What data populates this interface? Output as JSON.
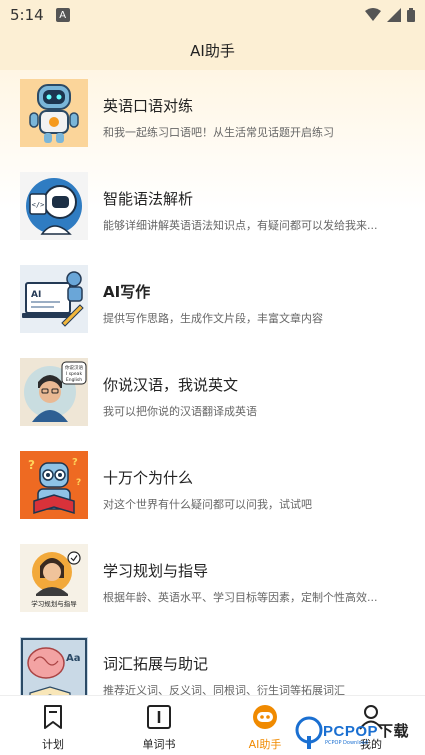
{
  "status_bar": {
    "time": "5:14",
    "notification_letter": "A"
  },
  "header": {
    "title": "AI助手"
  },
  "items": [
    {
      "title": "英语口语对练",
      "subtitle": "和我一起练习口语吧！从生活常见话题开启练习",
      "icon": "robot-mascot-icon"
    },
    {
      "title": "智能语法解析",
      "subtitle": "能够详细讲解英语语法知识点，有疑问都可以发给我来...",
      "icon": "astronaut-robot-icon"
    },
    {
      "title": "AI写作",
      "subtitle": "提供写作思路，生成作文片段，丰富文章内容",
      "icon": "laptop-writing-icon",
      "thumb_label": "AI"
    },
    {
      "title": "你说汉语，我说英文",
      "subtitle": "我可以把你说的汉语翻译成英语",
      "icon": "translator-person-icon",
      "thumb_bubble": [
        "你说汉语",
        "I speak",
        "English"
      ]
    },
    {
      "title": "十万个为什么",
      "subtitle": "对这个世界有什么疑问都可以问我，试试吧",
      "icon": "reading-robot-icon"
    },
    {
      "title": "学习规划与指导",
      "subtitle": "根据年龄、英语水平、学习目标等因素，定制个性高效...",
      "icon": "study-planner-icon",
      "thumb_label": "学习规划与指导"
    },
    {
      "title": "词汇拓展与助记",
      "subtitle": "推荐近义词、反义词、同根词、衍生词等拓展词汇",
      "icon": "brain-vocabulary-icon",
      "thumb_label": "Aa"
    }
  ],
  "tabs": [
    {
      "label": "计划",
      "icon": "bookmark-icon",
      "active": false
    },
    {
      "label": "单词书",
      "icon": "book-icon",
      "active": false
    },
    {
      "label": "AI助手",
      "icon": "ai-assistant-icon",
      "active": true
    },
    {
      "label": "我的",
      "icon": "person-icon",
      "active": false
    }
  ],
  "watermark": {
    "text": "PCPOP",
    "text_dl": "下载",
    "sub": "PCPOP Download"
  },
  "colors": {
    "accent": "#f08a00",
    "header_bg": "#fcefd4",
    "watermark": "#1a6fd1"
  }
}
